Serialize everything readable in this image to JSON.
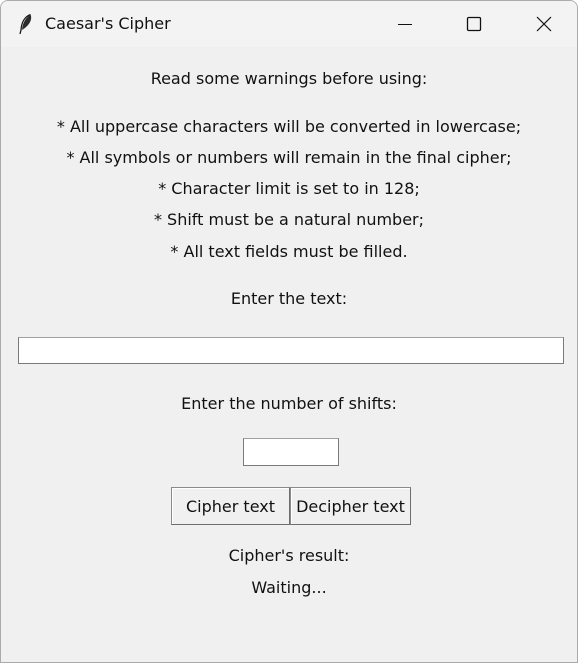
{
  "window": {
    "title": "Caesar's Cipher",
    "icon": "feather-icon",
    "controls": [
      "minimize-icon",
      "maximize-icon",
      "close-icon"
    ]
  },
  "warnings": {
    "heading": "Read some warnings before using:",
    "items": [
      "* All uppercase characters will be converted in lowercase;",
      "* All symbols or numbers will remain in the final cipher;",
      "* Character limit is set to in 128;",
      "* Shift must be a natural number;",
      "* All text fields must be filled."
    ]
  },
  "text_field": {
    "label": "Enter the text:",
    "value": ""
  },
  "shift_field": {
    "label": "Enter the number of shifts:",
    "value": ""
  },
  "buttons": {
    "cipher": "Cipher text",
    "decipher": "Decipher text"
  },
  "result": {
    "label": "Cipher's result:",
    "status": "Waiting..."
  }
}
